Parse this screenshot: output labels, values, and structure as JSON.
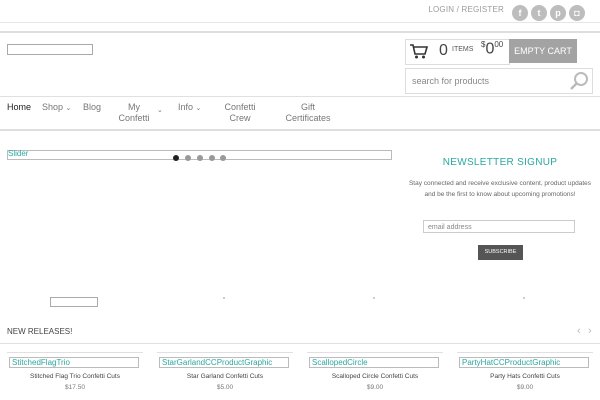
{
  "header": {
    "login_label": "LOGIN / REGISTER",
    "social": [
      {
        "icon": "facebook-icon",
        "glyph": "f"
      },
      {
        "icon": "twitter-icon",
        "glyph": "t"
      },
      {
        "icon": "pinterest-icon",
        "glyph": "p"
      },
      {
        "icon": "instagram-icon",
        "glyph": "◘"
      }
    ]
  },
  "cart": {
    "count": "0",
    "items_label": "ITEMS",
    "currency": "$",
    "amount": "0",
    "cents": "00",
    "empty_label": "EMPTY CART"
  },
  "search": {
    "placeholder": "search for products"
  },
  "nav": [
    {
      "label": "Home",
      "caret": ""
    },
    {
      "label": "Shop",
      "caret": "⌄"
    },
    {
      "label": "Blog",
      "caret": ""
    },
    {
      "label": "My Confetti",
      "caret": "⌄"
    },
    {
      "label": "Info",
      "caret": "⌄"
    },
    {
      "label": "Confetti Crew",
      "caret": ""
    },
    {
      "label": "Gift Certificates",
      "caret": ""
    }
  ],
  "slider": {
    "label": "Slider",
    "dot_count": 5,
    "active_dot": 0
  },
  "newsletter": {
    "title": "NEWSLETTER SIGNUP",
    "text": "Stay connected and receive exclusive content, product updates and be the first to know about upcoming promotions!",
    "placeholder": "email address",
    "button_label": "SUBSCRIBE"
  },
  "new_releases": {
    "title": "NEW RELEASES!",
    "prev_glyph": "‹",
    "next_glyph": "›",
    "products": [
      {
        "image_alt": "StitchedFlagTrio",
        "name": "Stitched Flag Trio Confetti Cuts",
        "price": "$17.50"
      },
      {
        "image_alt": "StarGarlandCCProductGraphic",
        "name": "Star Garland Confetti Cuts",
        "price": "$5.00"
      },
      {
        "image_alt": "ScallopedCircle",
        "name": "Scalloped Circle Confetti Cuts",
        "price": "$9.00"
      },
      {
        "image_alt": "PartyHatCCProductGraphic",
        "name": "Party Hats Confetti Cuts",
        "price": "$9.00"
      }
    ]
  },
  "colors": {
    "accent": "#2aa7a0",
    "button_gray": "#a3a3a3",
    "subscribe_bg": "#555555"
  }
}
